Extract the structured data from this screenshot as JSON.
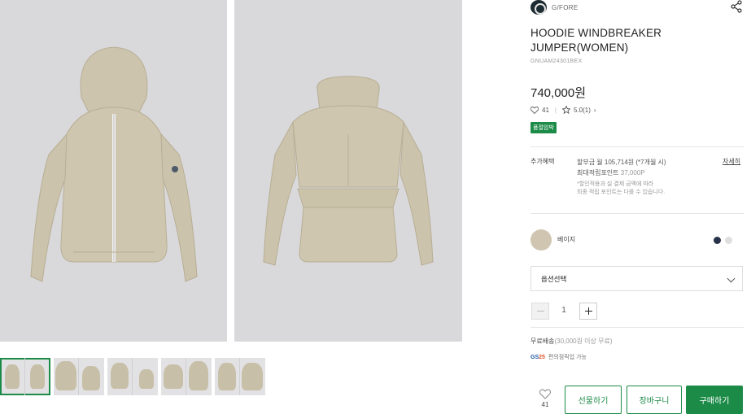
{
  "gallery": {
    "main_images": [
      {
        "name": "front view"
      },
      {
        "name": "back view"
      }
    ],
    "thumbnails_count": 5
  },
  "brand": {
    "name": "G/FORE"
  },
  "product": {
    "title": "HOODIE WINDBREAKER JUMPER(WOMEN)",
    "code": "GNUAM24301BEX",
    "price": "740,000원",
    "likes": "41",
    "rating": "5.0(1)",
    "badge": "품절임박"
  },
  "benefits": {
    "label": "추가혜택",
    "installment": "할부금 월 105,714원 (*7개월 시)",
    "points_label": "최대적립포인트",
    "points_value": "37,000P",
    "note_line1": "*할인적용과 실 결제 금액에 따라",
    "note_line2": "최종 적립 포인트는 다를 수 있습니다.",
    "detail_link": "자세히"
  },
  "color": {
    "selected_name": "베이지",
    "selected_hex": "#cfc5b1",
    "options": [
      "#27324a",
      "#dedede"
    ]
  },
  "option_select": {
    "placeholder": "옵션선택"
  },
  "quantity": {
    "value": "1"
  },
  "shipping": {
    "label": "무료배송",
    "condition": "(30,000원 이상 무료)",
    "gs_label": "편의점픽업 가능"
  },
  "actions": {
    "wish_count": "41",
    "gift": "선물하기",
    "cart": "장바구니",
    "buy": "구매하기"
  },
  "colors": {
    "accent": "#1c8b48"
  }
}
